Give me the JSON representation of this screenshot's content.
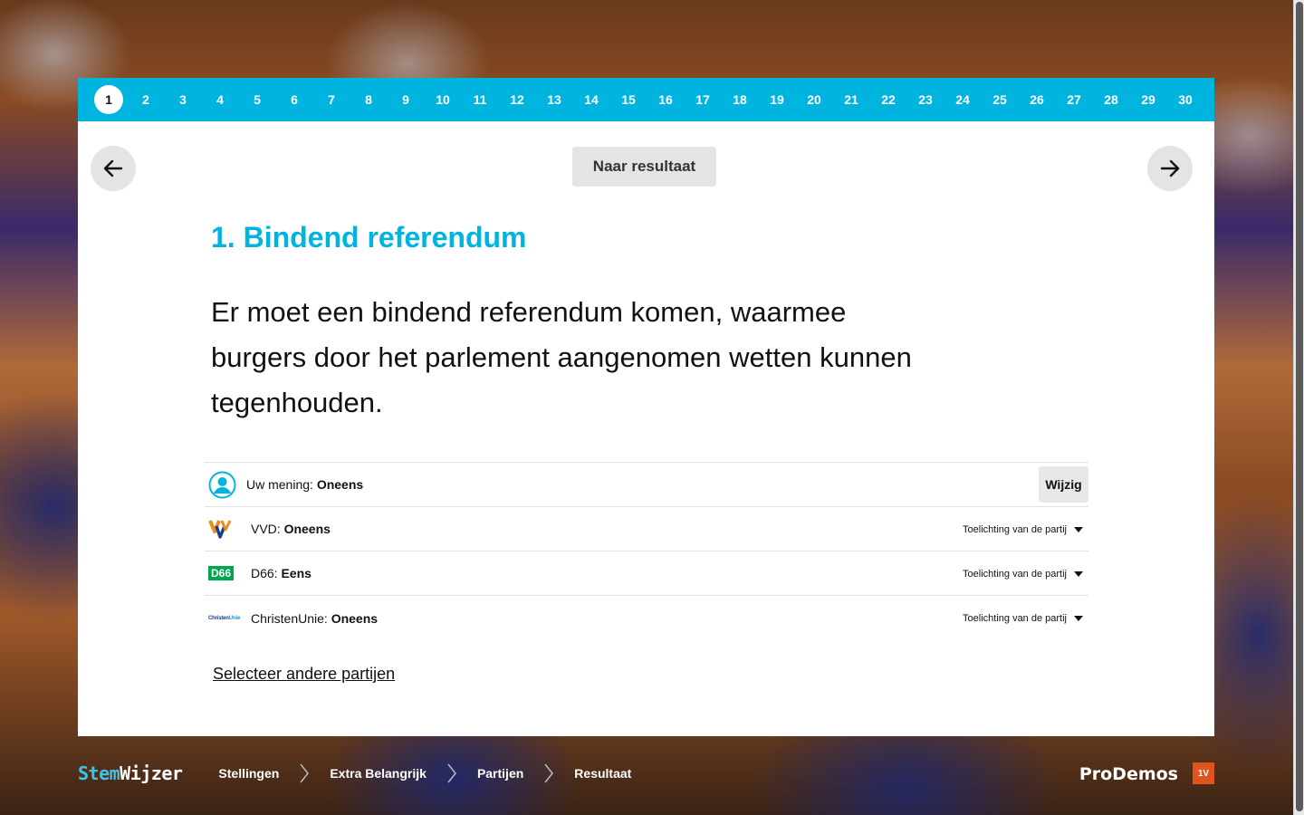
{
  "steps": [
    "1",
    "2",
    "3",
    "4",
    "5",
    "6",
    "7",
    "8",
    "9",
    "10",
    "11",
    "12",
    "13",
    "14",
    "15",
    "16",
    "17",
    "18",
    "19",
    "20",
    "21",
    "22",
    "23",
    "24",
    "25",
    "26",
    "27",
    "28",
    "29",
    "30"
  ],
  "active_step": "1",
  "header": {
    "result_button": "Naar resultaat"
  },
  "statement": {
    "title": "1. Bindend referendum",
    "text": "Er moet een bindend referendum komen, waarmee burgers door het parlement aangenomen wetten kunnen tegenhouden."
  },
  "user_opinion": {
    "prefix": "Uw mening: ",
    "value": "Oneens",
    "change_label": "Wijzig"
  },
  "parties": [
    {
      "name": "VVD: ",
      "opinion": "Oneens",
      "explain": "Toelichting van de partij"
    },
    {
      "name": "D66: ",
      "opinion": "Eens",
      "explain": "Toelichting van de partij",
      "logo_text": "D66"
    },
    {
      "name": "ChristenUnie: ",
      "opinion": "Oneens",
      "explain": "Toelichting van de partij",
      "logo_text_a": "Christen",
      "logo_text_b": "Unie"
    }
  ],
  "select_other": "Selecteer andere partijen",
  "footer": {
    "brand_a": "Stem",
    "brand_b": "Wijzer",
    "crumbs": [
      "Stellingen",
      "Extra Belangrijk",
      "Partijen",
      "Resultaat"
    ],
    "prodemos": "ProDemos",
    "badge": "1V"
  },
  "colors": {
    "accent": "#00b4e0",
    "d66": "#00a651",
    "badge": "#e0541f"
  }
}
